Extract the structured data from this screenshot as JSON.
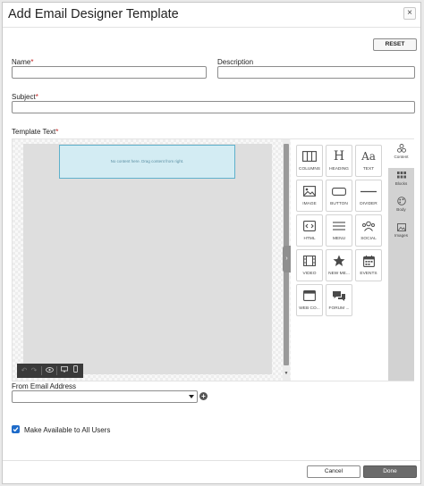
{
  "dialog": {
    "title": "Add Email Designer Template",
    "close_glyph": "×",
    "reset_label": "RESET"
  },
  "form": {
    "name_label": "Name",
    "description_label": "Description",
    "subject_label": "Subject",
    "template_text_label": "Template Text",
    "required_mark": "*",
    "name_value": "",
    "description_value": "",
    "subject_value": "",
    "from_email_label": "From Email Address",
    "from_email_value": "",
    "make_available_label": "Make Available to All Users",
    "make_available_checked": true
  },
  "editor": {
    "placeholder": "No content here. Drag content from right.",
    "toolbar": [
      "undo-icon",
      "redo-icon",
      "preview-eye-icon",
      "desktop-view-icon",
      "mobile-view-icon"
    ],
    "content_blocks": [
      {
        "label": "COLUMNS",
        "icon": "columns-icon"
      },
      {
        "label": "HEADING",
        "icon": "heading-icon"
      },
      {
        "label": "TEXT",
        "icon": "text-icon"
      },
      {
        "label": "IMAGE",
        "icon": "image-icon"
      },
      {
        "label": "BUTTON",
        "icon": "button-icon"
      },
      {
        "label": "DIVIDER",
        "icon": "divider-icon"
      },
      {
        "label": "HTML",
        "icon": "html-icon"
      },
      {
        "label": "MENU",
        "icon": "menu-icon"
      },
      {
        "label": "SOCIAL",
        "icon": "social-icon"
      },
      {
        "label": "VIDEO",
        "icon": "video-icon"
      },
      {
        "label": "NEW ME...",
        "icon": "star-icon"
      },
      {
        "label": "EVENTS",
        "icon": "calendar-icon"
      },
      {
        "label": "WEB CO...",
        "icon": "web-component-icon"
      },
      {
        "label": "FORUM ...",
        "icon": "forum-icon"
      }
    ],
    "side_tabs": [
      {
        "label": "Content",
        "icon": "content-icon",
        "active": true
      },
      {
        "label": "Blocks",
        "icon": "blocks-icon",
        "active": false
      },
      {
        "label": "Body",
        "icon": "body-icon",
        "active": false
      },
      {
        "label": "Images",
        "icon": "images-icon",
        "active": false
      }
    ]
  },
  "footer": {
    "cancel_label": "Cancel",
    "done_label": "Done"
  },
  "colors": {
    "accent_blue": "#1e6bc9",
    "required_red": "#c21f1f",
    "done_button": "#6b6b6b",
    "drop_zone": "#d3ecf3"
  }
}
